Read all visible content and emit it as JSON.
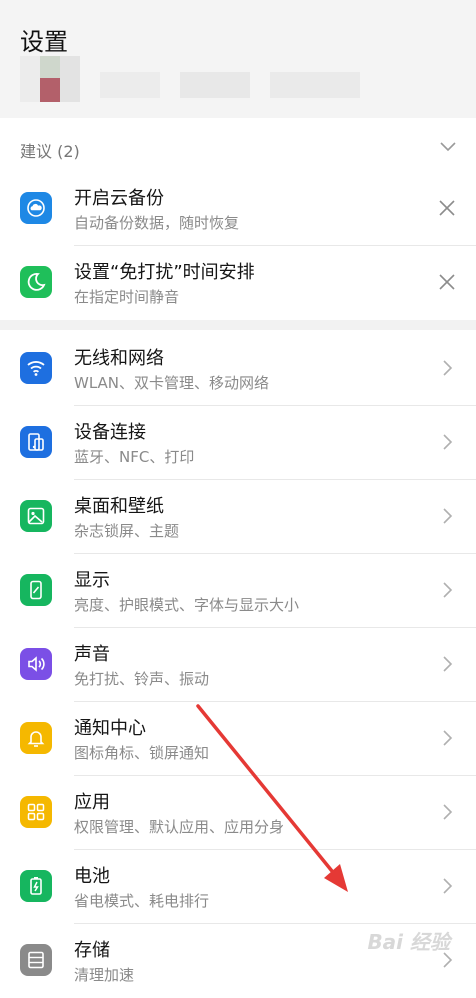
{
  "header": {
    "title": "设置"
  },
  "suggestions": {
    "label": "建议 (2)",
    "items": [
      {
        "title": "开启云备份",
        "subtitle": "自动备份数据，随时恢复"
      },
      {
        "title": "设置“免打扰”时间安排",
        "subtitle": "在指定时间静音"
      }
    ]
  },
  "settings": [
    {
      "title": "无线和网络",
      "subtitle": "WLAN、双卡管理、移动网络"
    },
    {
      "title": "设备连接",
      "subtitle": "蓝牙、NFC、打印"
    },
    {
      "title": "桌面和壁纸",
      "subtitle": "杂志锁屏、主题"
    },
    {
      "title": "显示",
      "subtitle": "亮度、护眼模式、字体与显示大小"
    },
    {
      "title": "声音",
      "subtitle": "免打扰、铃声、振动"
    },
    {
      "title": "通知中心",
      "subtitle": "图标角标、锁屏通知"
    },
    {
      "title": "应用",
      "subtitle": "权限管理、默认应用、应用分身"
    },
    {
      "title": "电池",
      "subtitle": "省电模式、耗电排行"
    },
    {
      "title": "存储",
      "subtitle": "清理加速"
    }
  ],
  "watermark": "Bai 经验",
  "colors": {
    "cloud": "#1e88e5",
    "moon": "#1fbf5a",
    "wifi": "#1e6fe0",
    "device": "#1e6fe0",
    "wallpaper": "#16b65f",
    "display": "#16b65f",
    "sound": "#7b4fe6",
    "notify": "#f5b800",
    "apps": "#f5b800",
    "battery": "#16b65f",
    "storage": "#8a8a8a",
    "annotation": "#e53935"
  }
}
